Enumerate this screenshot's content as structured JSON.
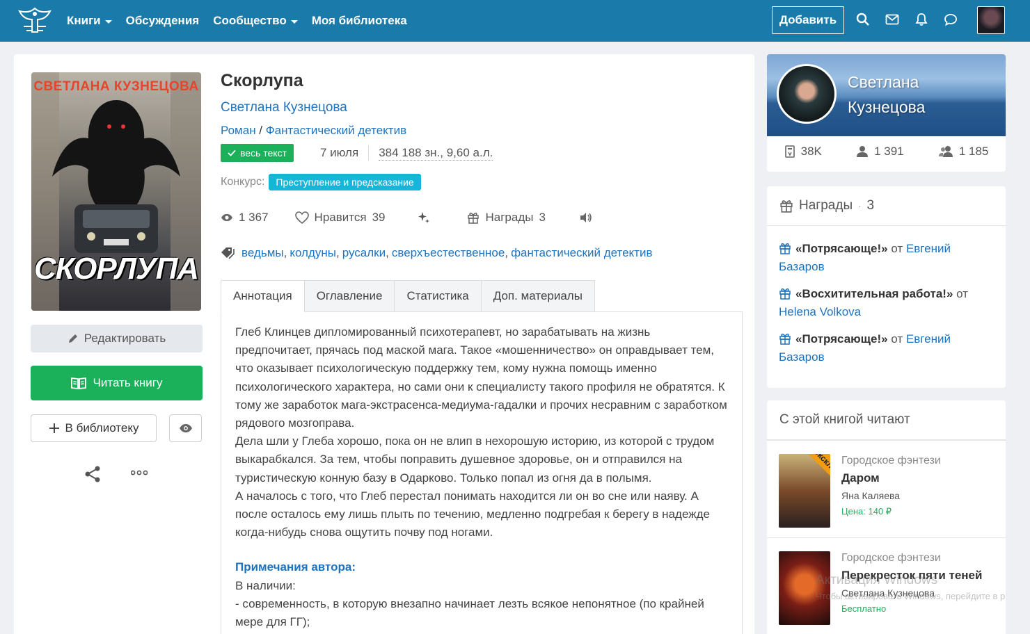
{
  "nav": {
    "items": [
      {
        "label": "Книги",
        "caret": true
      },
      {
        "label": "Обсуждения",
        "caret": false
      },
      {
        "label": "Сообщество",
        "caret": true
      },
      {
        "label": "Моя библиотека",
        "caret": false
      }
    ],
    "add_label": "Добавить",
    "icons": [
      "search-icon",
      "mail-icon",
      "bell-icon",
      "chat-icon"
    ]
  },
  "book": {
    "cover_author": "СВЕТЛАНА КУЗНЕЦОВА",
    "cover_title": "СКОРЛУПА",
    "title": "Скорлупа",
    "author": "Светлана Кузнецова",
    "genre_main": "Роман",
    "genre_sep": " / ",
    "genre_sub": "Фантастический детектив",
    "full_text_badge": "весь текст",
    "date": "7 июля",
    "size": "384 188 зн., 9,60 а.л.",
    "contest_label": "Конкурс:",
    "contest_name": "Преступление и предсказание",
    "views": "1 367",
    "likes_label": "Нравится",
    "likes": "39",
    "awards_label": "Награды",
    "awards_count": "3",
    "tags": [
      "ведьмы",
      "колдуны",
      "русалки",
      "сверхъестественное",
      "фантастический детектив"
    ]
  },
  "actions": {
    "edit": "Редактировать",
    "read": "Читать книгу",
    "library": "В библиотеку"
  },
  "tabs": [
    "Аннотация",
    "Оглавление",
    "Статистика",
    "Доп. материалы"
  ],
  "annotation": {
    "p1": "Глеб Клинцев дипломированный психотерапевт, но зарабатывать на жизнь предпочитает, прячась под маской мага. Такое «мошенничество» он оправдывает тем, что оказывает психологическую поддержку тем, кому нужна помощь именно психологического характера, но сами они к специалисту такого профиля не обратятся. К тому же заработок мага-экстрасенса-медиума-гадалки и прочих несравним с заработком рядового мозгоправа.",
    "p2": "Дела шли у Глеба хорошо, пока он не влип в нехорошую историю, из которой с трудом выкарабкался. За тем, чтобы поправить душевное здоровье, он и отправился на туристическую конную базу в Одарково. Только попал из огня да в полымя.",
    "p3": "А началось с того, что Глеб перестал понимать находится ли он во сне или наяву. А после осталось ему лишь плыть по течению, медленно подгребая к берегу в надежде когда-нибудь снова ощутить почву под ногами.",
    "notes_title": "Примечания автора:",
    "notes_intro": "В наличии:",
    "notes_item1": "- современность, в которую внезапно начинает лезть всякое непонятное (по крайней мере для ГГ);"
  },
  "author_card": {
    "name_line1": "Светлана",
    "name_line2": "Кузнецова",
    "books": "38K",
    "followers": "1 391",
    "friends": "1 185"
  },
  "awards": {
    "title": "Награды",
    "sep": "·",
    "count": "3",
    "items": [
      {
        "name": "«Потрясающе!»",
        "from": "от",
        "by": "Евгений Базаров"
      },
      {
        "name": "«Восхитительная работа!»",
        "from": "от",
        "by": "Helena Volkova"
      },
      {
        "name": "«Потрясающе!»",
        "from": "от",
        "by": "Евгений Базаров"
      }
    ]
  },
  "also_reading": {
    "title": "С этой книгой читают",
    "items": [
      {
        "genre": "Городское фэнтези",
        "title": "Даром",
        "author": "Яна Каляева",
        "price": "Цена: 140 ₽",
        "ribbon": "Эксклюзив"
      },
      {
        "genre": "Городское фэнтези",
        "title": "Перекресток пяти теней",
        "author": "Светлана Кузнецова",
        "price": "Бесплатно"
      }
    ]
  },
  "watermark": {
    "line1": "Активация Windows",
    "line2": "Чтобы активировать Windows, перейдите в р"
  },
  "colors": {
    "topbar": "#1a7aaa",
    "link": "#1e73be",
    "green": "#1ab15a",
    "contest": "#17b6d8"
  }
}
